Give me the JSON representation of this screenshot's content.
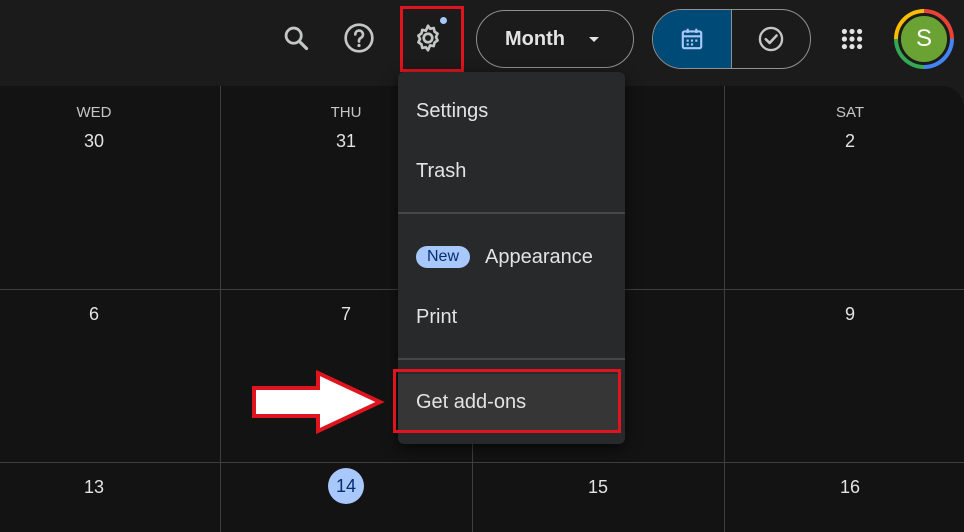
{
  "header": {
    "view_selector": "Month",
    "avatar_initial": "S"
  },
  "calendar": {
    "day_headers": [
      "WED",
      "THU",
      "SAT"
    ],
    "week1": [
      "30",
      "31",
      "2"
    ],
    "week2": [
      "6",
      "7",
      "9"
    ],
    "week3": [
      "13",
      "14",
      "15",
      "16"
    ],
    "today": "14"
  },
  "settings_menu": {
    "items": [
      "Settings",
      "Trash",
      "Appearance",
      "Print",
      "Get add-ons"
    ],
    "new_badge": "New"
  },
  "colors": {
    "accent": "#a8c7fa",
    "highlight_box": "#e0141e",
    "active_toggle": "#004a77",
    "avatar": "#6aa334"
  }
}
